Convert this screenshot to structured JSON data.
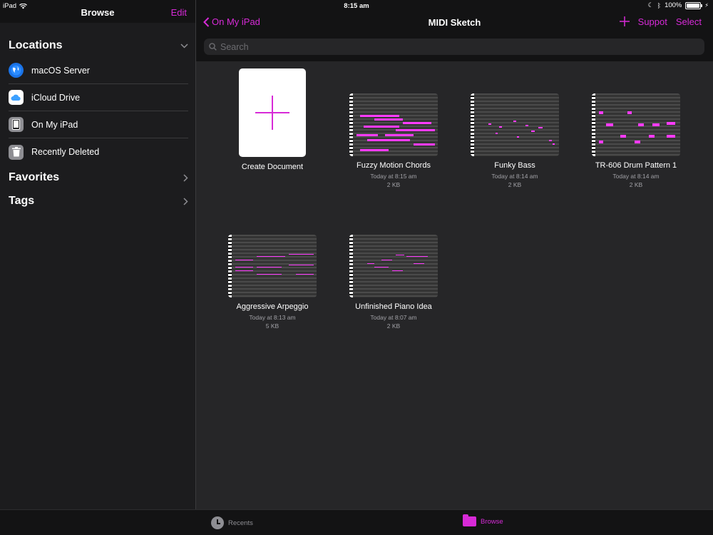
{
  "status_bar": {
    "device": "iPad",
    "time": "8:15 am",
    "battery": "100%"
  },
  "sidebar": {
    "title": "Browse",
    "edit_label": "Edit",
    "locations_label": "Locations",
    "locations": [
      {
        "label": "macOS Server",
        "icon": "globe-icon",
        "color": "#1a73e8"
      },
      {
        "label": "iCloud Drive",
        "icon": "cloud-icon",
        "color": "#ffffff"
      },
      {
        "label": "On My iPad",
        "icon": "ipad-icon",
        "color": "#8e8e93"
      },
      {
        "label": "Recently Deleted",
        "icon": "trash-icon",
        "color": "#8e8e93"
      }
    ],
    "favorites_label": "Favorites",
    "tags_label": "Tags"
  },
  "navbar": {
    "back_label": "On My iPad",
    "title": "MIDI Sketch",
    "support_label": "Suppot",
    "select_label": "Select",
    "search_placeholder": "Search"
  },
  "documents": [
    {
      "title": "Create Document",
      "date": "",
      "size": ""
    },
    {
      "title": "Fuzzy Motion Chords",
      "date": "Today at 8:15 am",
      "size": "2 KB"
    },
    {
      "title": "Funky Bass",
      "date": "Today at 8:14 am",
      "size": "2 KB"
    },
    {
      "title": "TR-606 Drum Pattern 1",
      "date": "Today at 8:14 am",
      "size": "2 KB"
    },
    {
      "title": "Aggressive Arpeggio",
      "date": "Today at 8:13 am",
      "size": "5 KB"
    },
    {
      "title": "Unfinished Piano Idea",
      "date": "Today at 8:07 am",
      "size": "2 KB"
    }
  ],
  "tabbar": {
    "recents_label": "Recents",
    "browse_label": "Browse"
  },
  "colors": {
    "accent": "#d72ad7",
    "note": "#ff3bff",
    "background": "#1c1c1e"
  }
}
